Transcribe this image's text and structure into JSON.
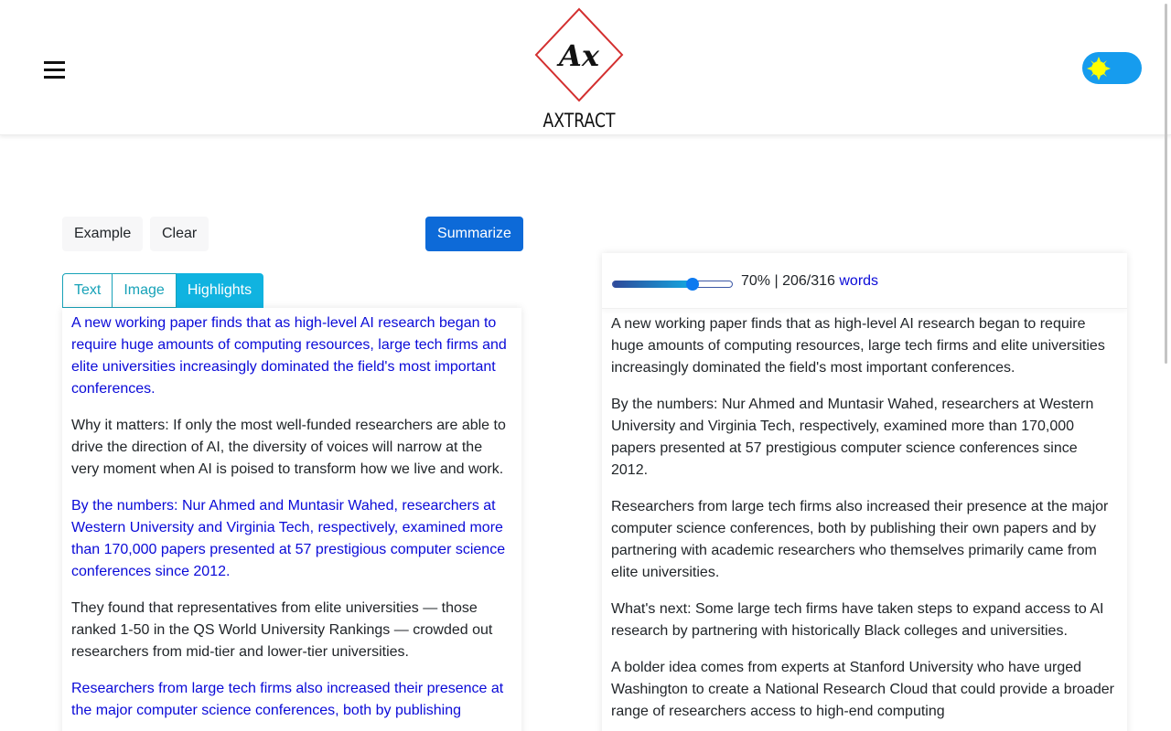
{
  "header": {
    "logo_text": "AXTRACT",
    "logo_mark": "Ax",
    "menu_icon": "hamburger-icon",
    "theme_toggle_icon": "sun-icon"
  },
  "toolbar": {
    "example_label": "Example",
    "clear_label": "Clear",
    "summarize_label": "Summarize"
  },
  "tabs": [
    {
      "label": "Text",
      "active": false
    },
    {
      "label": "Image",
      "active": false
    },
    {
      "label": "Highlights",
      "active": true
    }
  ],
  "highlights_panel": {
    "paragraphs": [
      {
        "text": "A new working paper finds that as high-level AI research began to require huge amounts of computing resources, large tech firms and elite universities increasingly dominated the field's most important conferences.",
        "highlighted": true
      },
      {
        "text": "Why it matters: If only the most well-funded researchers are able to drive the direction of AI, the diversity of voices will narrow at the very moment when AI is poised to transform how we live and work.",
        "highlighted": false
      },
      {
        "text": "By the numbers: Nur Ahmed and Muntasir Wahed, researchers at Western University and Virginia Tech, respectively, examined more than 170,000 papers presented at 57 prestigious computer science conferences since 2012.",
        "highlighted": true
      },
      {
        "text": "They found that representatives from elite universities — those ranked 1-50 in the QS World University Rankings — crowded out researchers from mid-tier and lower-tier universities.",
        "highlighted": false
      },
      {
        "text": "Researchers from large tech firms also increased their presence at the major computer science conferences, both by publishing",
        "highlighted": true
      }
    ]
  },
  "summary_panel": {
    "slider_percent": 70,
    "readout": "70% | 206/316",
    "words_label": "words",
    "paragraphs": [
      "A new working paper finds that as high-level AI research began to require huge amounts of computing resources, large tech firms and elite universities increasingly dominated the field's most important conferences.",
      "By the numbers: Nur Ahmed and Muntasir Wahed, researchers at Western University and Virginia Tech, respectively, examined more than 170,000 papers presented at 57 prestigious computer science conferences since 2012.",
      "Researchers from large tech firms also increased their presence at the major computer science conferences, both by publishing their own papers and by partnering with academic researchers who themselves primarily came from elite universities.",
      "What's next: Some large tech firms have taken steps to expand access to AI research by partnering with historically Black colleges and universities.",
      "A bolder idea comes from experts at Stanford University who have urged Washington to create a National Research Cloud that could provide a broader range of researchers access to high-end computing"
    ]
  },
  "colors": {
    "summarize_button": "#0d6ad8",
    "tab_accent": "#17a2b8",
    "tab_active_bg": "#10b3e0",
    "highlight_text": "#0a0ad8",
    "toggle_bg": "#169cee",
    "sun": "#ffff00",
    "logo_diamond": "#d32f2f"
  }
}
